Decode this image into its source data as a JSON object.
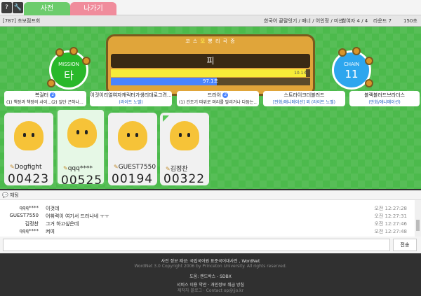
{
  "colors": {
    "tab_dict": "#6ccc6c",
    "tab_exit": "#f08c9c",
    "board": "#e0a53a",
    "mission": "#29b82a",
    "chain": "#2da6ee",
    "game_bg": "#4cba4c"
  },
  "topbar": {
    "help_icon": "?",
    "tool_icon": "🔧",
    "tabs": [
      {
        "label": "사전"
      },
      {
        "label": "나가기"
      }
    ]
  },
  "room": {
    "id_label": "[787] 초보점프회",
    "info": "한국어 끝말잇기 / 매너 / 어인정 / 미션",
    "players": "참여자 4 / 4",
    "round": "라운드 7",
    "time": "150초"
  },
  "board": {
    "title_pre": "코 스 ",
    "title_hl": "모",
    "title_post": " 뽕 리 곡 증",
    "word": "피",
    "turn_time_fraction": 0.98,
    "turn_time_label": "10.1초",
    "round_time_fraction": 0.53,
    "round_time_label": "97.1초"
  },
  "mission": {
    "caption": "MISSION",
    "value": "타"
  },
  "chain": {
    "caption": "CHAIN",
    "value": "11"
  },
  "cards": [
    {
      "title": "복걸터",
      "num": "2",
      "desc": "(1) 책장과 책장의 사이...(2) 일단 곤하나...",
      "blue": false
    },
    {
      "title": "이것이리얼여자캐릭터가생리대로그려...",
      "num": "",
      "desc": "(라이트 노벨)",
      "blue": true
    },
    {
      "title": "드라이",
      "num": "2",
      "desc": "(1) 건조기 따위로 머리를 말리거나 다듬는...",
      "blue": false
    },
    {
      "title": "스트라이크더블러드",
      "num": "",
      "desc": "[만화/애니메이션] 외 (라이트 노벨)",
      "blue": true
    },
    {
      "title": "블랙블러드브라더스",
      "num": "",
      "desc": "(만화/애니메이션)",
      "blue": true
    }
  ],
  "players": [
    {
      "nick": "Dogfight",
      "score": "00423",
      "active": false
    },
    {
      "nick": "qqq****",
      "score": "00525",
      "active": true
    },
    {
      "nick": "GUEST7550",
      "score": "00194",
      "active": false
    },
    {
      "nick": "김정찬",
      "score": "00322",
      "active": false
    }
  ],
  "chat": {
    "header": "채팅",
    "messages": [
      {
        "nick": "qqq****",
        "msg": "이것데",
        "time": "오전 12:27:28"
      },
      {
        "nick": "GUEST7550",
        "msg": "어휘력이 여기서 드러나네 ㅜㅜ",
        "time": "오전 12:27:31"
      },
      {
        "nick": "김정찬",
        "msg": "그거 하고싶은데",
        "time": "오전 12:27:46"
      },
      {
        "nick": "qqq****",
        "msg": "켜여",
        "time": "오전 12:27:48"
      }
    ],
    "input_placeholder": "",
    "send_label": "전송"
  },
  "footer": {
    "line1": "사전 정보 제공: 국립국어원 표준국어대사전 , WordNet",
    "line2": "WordNet 3.0 Copyright 2006 by Princeton University. All rights reserved.",
    "line3": "도움: 랜드박스 - SDBX",
    "line4": "서비스 이용 약관 · 개인정보 취급 방침",
    "line5": "제작자 블로그 · Contact op@jjo.kr"
  }
}
